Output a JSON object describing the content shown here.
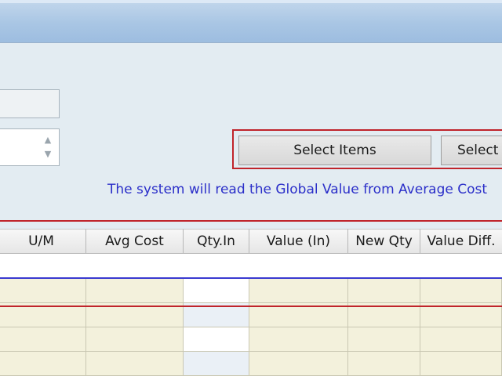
{
  "buttons": {
    "select_items": "Select Items",
    "select_more": "Select I"
  },
  "info_text": "The system will read the Global Value from Average Cost",
  "grid": {
    "columns": [
      "U/M",
      "Avg Cost",
      "Qty.In",
      "Value (In)",
      "New Qty",
      "Value Diff."
    ]
  },
  "colors": {
    "highlight_border": "#c0242b",
    "info_text": "#2b2fc9",
    "new_row_border": "#3a3ad0",
    "readonly_cell": "#f3f1dc"
  }
}
